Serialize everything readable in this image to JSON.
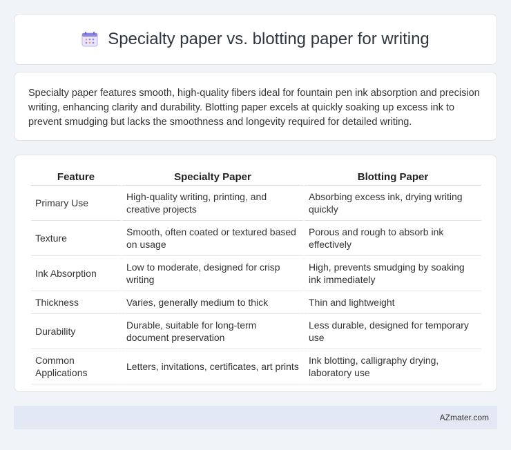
{
  "header": {
    "title": "Specialty paper vs. blotting paper for writing",
    "icon": "calendar-icon"
  },
  "summary": "Specialty paper features smooth, high-quality fibers ideal for fountain pen ink absorption and precision writing, enhancing clarity and durability. Blotting paper excels at quickly soaking up excess ink to prevent smudging but lacks the smoothness and longevity required for detailed writing.",
  "table": {
    "headers": [
      "Feature",
      "Specialty Paper",
      "Blotting Paper"
    ],
    "rows": [
      [
        "Primary Use",
        "High-quality writing, printing, and creative projects",
        "Absorbing excess ink, drying writing quickly"
      ],
      [
        "Texture",
        "Smooth, often coated or textured based on usage",
        "Porous and rough to absorb ink effectively"
      ],
      [
        "Ink Absorption",
        "Low to moderate, designed for crisp writing",
        "High, prevents smudging by soaking ink immediately"
      ],
      [
        "Thickness",
        "Varies, generally medium to thick",
        "Thin and lightweight"
      ],
      [
        "Durability",
        "Durable, suitable for long-term document preservation",
        "Less durable, designed for temporary use"
      ],
      [
        "Common Applications",
        "Letters, invitations, certificates, art prints",
        "Ink blotting, calligraphy drying, laboratory use"
      ]
    ]
  },
  "footer": {
    "brand": "AZmater.com"
  },
  "colors": {
    "background": "#f0f3f8",
    "footer_bg": "#e3e9f4",
    "icon_accent": "#7b6fd6"
  }
}
